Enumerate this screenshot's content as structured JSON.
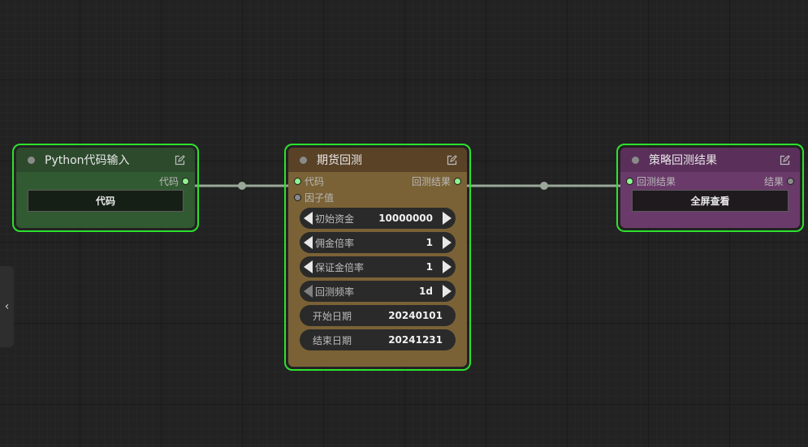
{
  "sidebar_toggle": {
    "glyph": "‹"
  },
  "nodes": {
    "python": {
      "title": "Python代码输入",
      "output_label": "代码",
      "button_label": "代码"
    },
    "futures": {
      "title": "期货回测",
      "input_code": "代码",
      "input_factor": "因子值",
      "output_label": "回测结果",
      "widgets": [
        {
          "label": "初始资金",
          "value": "10000000"
        },
        {
          "label": "佣金倍率",
          "value": "1"
        },
        {
          "label": "保证金倍率",
          "value": "1"
        },
        {
          "label": "回测频率",
          "value": "1d"
        }
      ],
      "start_date": {
        "label": "开始日期",
        "value": "20240101"
      },
      "end_date": {
        "label": "结束日期",
        "value": "20241231"
      }
    },
    "result": {
      "title": "策略回测结果",
      "input_label": "回测结果",
      "output_label": "结果",
      "button_label": "全屏查看"
    }
  },
  "colors": {
    "selection_border": "#2ce22c",
    "link": "#9aa89a",
    "slot_connected": "#8ff28f",
    "python_node": "#325a32",
    "futures_node": "#7a6236",
    "result_node": "#6a3a6a"
  }
}
